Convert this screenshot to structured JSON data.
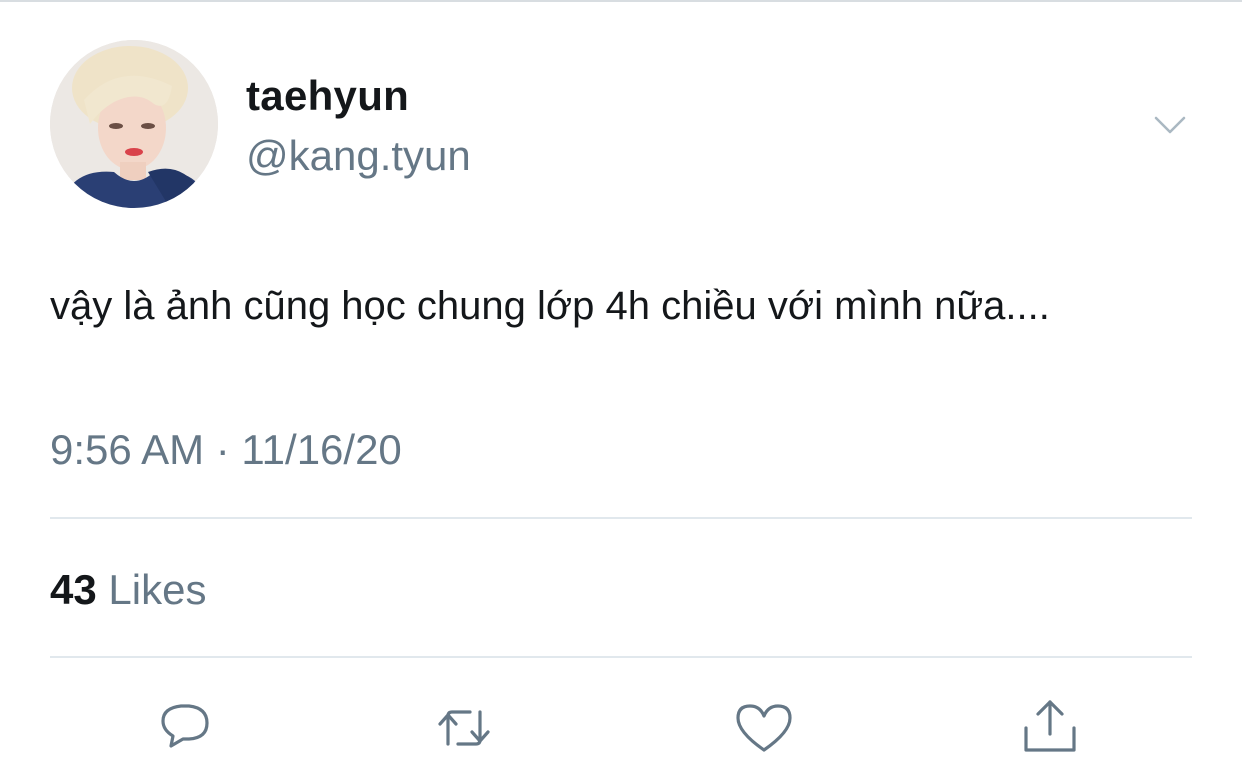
{
  "user": {
    "display_name": "taehyun",
    "handle": "@kang.tyun"
  },
  "tweet": {
    "text": "vậy là ảnh cũng học chung lớp 4h chiều với mình nữa....",
    "timestamp": "9:56 AM · 11/16/20"
  },
  "stats": {
    "likes_count": "43",
    "likes_label": "Likes"
  },
  "icons": {
    "more": "chevron-down-icon",
    "reply": "reply-icon",
    "retweet": "retweet-icon",
    "like": "heart-icon",
    "share": "share-icon"
  },
  "colors": {
    "primary_text": "#14171a",
    "secondary_text": "#657786",
    "divider": "#e1e8ed"
  }
}
